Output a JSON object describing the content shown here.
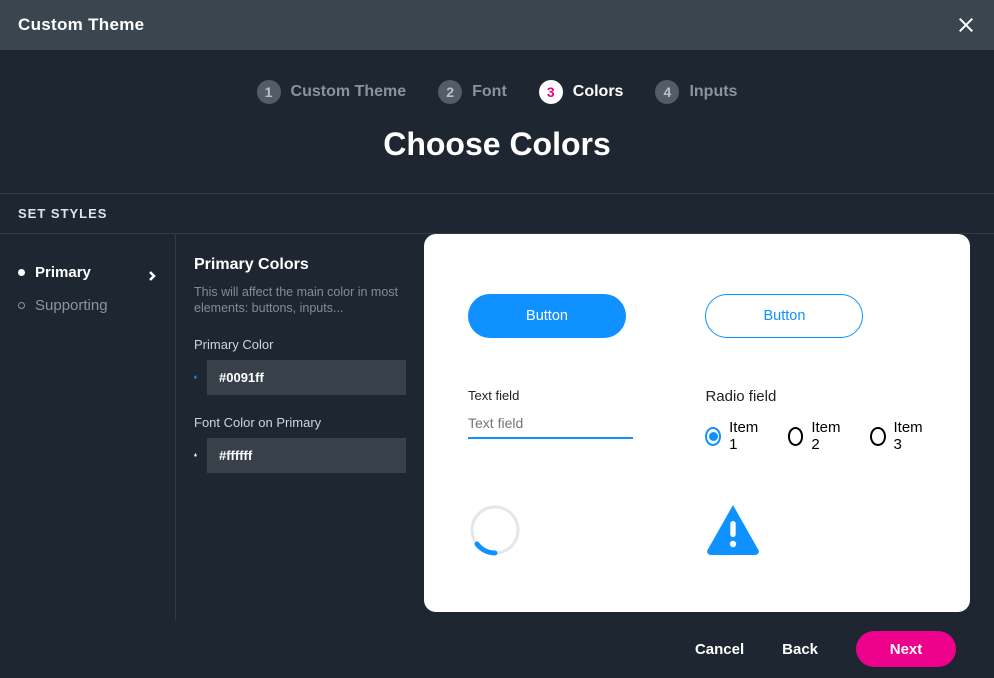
{
  "titlebar": {
    "title": "Custom Theme"
  },
  "stepper": {
    "steps": [
      {
        "num": "1",
        "label": "Custom Theme"
      },
      {
        "num": "2",
        "label": "Font"
      },
      {
        "num": "3",
        "label": "Colors"
      },
      {
        "num": "4",
        "label": "Inputs"
      }
    ]
  },
  "heading": "Choose Colors",
  "section_label": "SET STYLES",
  "sidebar": {
    "items": [
      {
        "label": "Primary"
      },
      {
        "label": "Supporting"
      }
    ]
  },
  "controls": {
    "title": "Primary Colors",
    "desc": "This will affect the main color in most elements: buttons, inputs...",
    "primary_label": "Primary Color",
    "primary_value": "#0091ff",
    "font_label": "Font Color on Primary",
    "font_value": "#ffffff"
  },
  "preview": {
    "button_filled": "Button",
    "button_outline": "Button",
    "textfield_label": "Text field",
    "textfield_placeholder": "Text field",
    "radio_label": "Radio field",
    "radio_items": [
      {
        "label": "Item 1"
      },
      {
        "label": "Item 2"
      },
      {
        "label": "Item 3"
      }
    ]
  },
  "footer": {
    "cancel": "Cancel",
    "back": "Back",
    "next": "Next"
  },
  "colors": {
    "primary": "#0091ff",
    "accent": "#ec008c",
    "font_on_primary": "#ffffff"
  }
}
